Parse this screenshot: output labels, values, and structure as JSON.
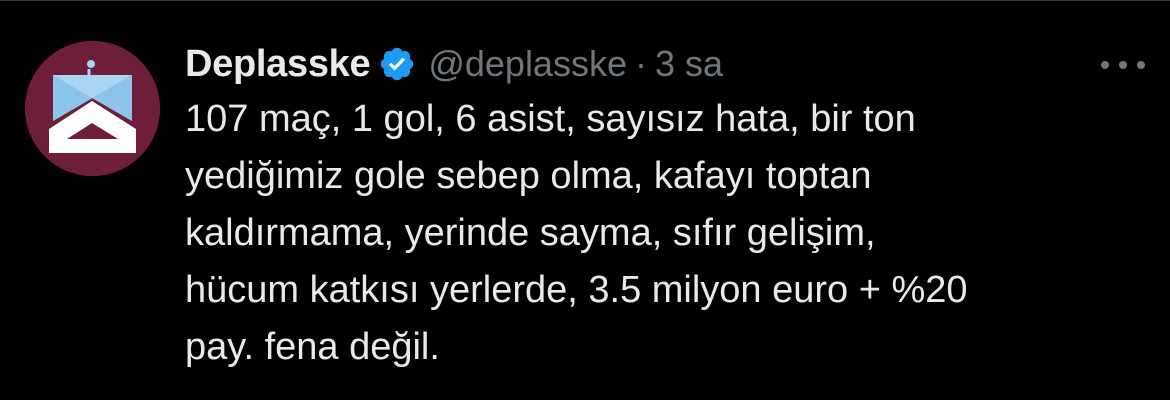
{
  "tweet": {
    "author": {
      "display_name": "Deplasske",
      "verified": true,
      "verified_icon": "verified-badge-icon",
      "handle": "@deplasske",
      "separator": "·",
      "time": "3 sa",
      "avatar_icon": "team-logo-avatar"
    },
    "more_icon": "more-horizontal-icon",
    "text": "107 maç, 1 gol, 6 asist, sayısız hata, bir ton\nyediğimiz gole sebep olma, kafayı toptan\nkaldırmama, yerinde sayma, sıfır gelişim,\nhücum katkısı yerlerde, 3.5 milyon euro + %20\npay. fena değil."
  },
  "colors": {
    "background": "#000000",
    "primary_text": "#e7e9ea",
    "secondary_text": "#71767b",
    "verified_blue": "#1d9bf0",
    "avatar_maroon": "#6e1e3a",
    "logo_light_blue": "#a9d4f2"
  }
}
